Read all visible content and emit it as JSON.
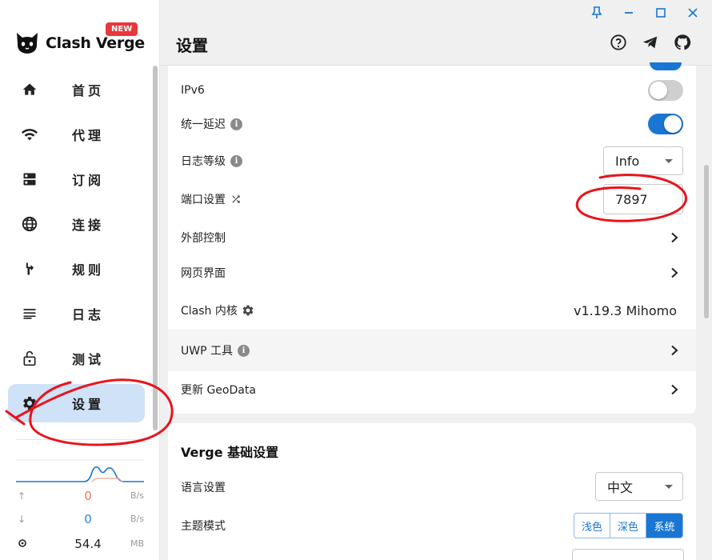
{
  "app": {
    "name": "Clash Verge",
    "badge": "NEW"
  },
  "header": {
    "title": "设置"
  },
  "sidebar": {
    "items": [
      {
        "label": "首页",
        "icon": "home-icon"
      },
      {
        "label": "代理",
        "icon": "wifi-icon"
      },
      {
        "label": "订阅",
        "icon": "dns-icon"
      },
      {
        "label": "连接",
        "icon": "globe-icon"
      },
      {
        "label": "规则",
        "icon": "fork-icon"
      },
      {
        "label": "日志",
        "icon": "list-icon"
      },
      {
        "label": "测试",
        "icon": "lock-icon"
      },
      {
        "label": "设置",
        "icon": "gear-icon",
        "active": true
      }
    ],
    "traffic": {
      "upload_value": "0",
      "upload_unit": "B/s",
      "download_value": "0",
      "download_unit": "B/s",
      "memory_value": "54.4",
      "memory_unit": "MB"
    }
  },
  "clash_settings": {
    "ipv6_label": "IPv6",
    "ipv6_enabled": false,
    "unified_delay_label": "统一延迟",
    "unified_delay_enabled": true,
    "log_level_label": "日志等级",
    "log_level_value": "Info",
    "port_label": "端口设置",
    "port_value": "7897",
    "external_control_label": "外部控制",
    "web_ui_label": "网页界面",
    "core_label": "Clash 内核",
    "core_version": "v1.19.3 Mihomo",
    "uwp_label": "UWP 工具",
    "geodata_label": "更新 GeoData"
  },
  "verge_settings": {
    "section_title": "Verge 基础设置",
    "language_label": "语言设置",
    "language_value": "中文",
    "theme_label": "主题模式",
    "theme_options": [
      "浅色",
      "深色",
      "系统"
    ],
    "theme_selected": "系统"
  },
  "colors": {
    "accent": "#1976d2",
    "active_nav": "#d0e2f8",
    "annotation_red": "#e8141c",
    "badge_red": "#e8383d"
  }
}
